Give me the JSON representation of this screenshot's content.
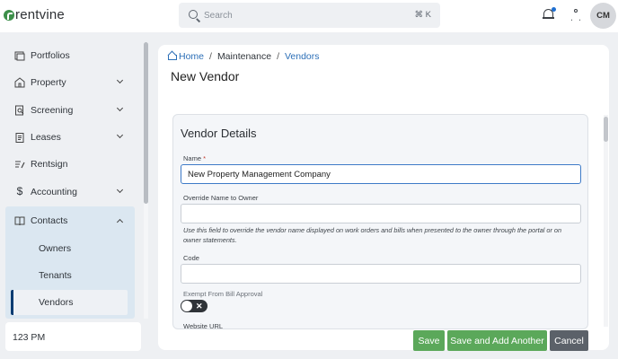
{
  "brand": {
    "wordmark": "rentvine"
  },
  "header": {
    "search_placeholder": "Search",
    "search_shortcut": "⌘ K",
    "avatar_initials": "CM",
    "notification_icon": "bell-icon",
    "profile_icon": "person-icon"
  },
  "sidebar": {
    "items": [
      {
        "label": "Portfolios",
        "icon": "portfolio-icon",
        "expandable": false
      },
      {
        "label": "Property",
        "icon": "property-icon",
        "expandable": true
      },
      {
        "label": "Screening",
        "icon": "screening-icon",
        "expandable": true
      },
      {
        "label": "Leases",
        "icon": "leases-icon",
        "expandable": true
      },
      {
        "label": "Rentsign",
        "icon": "rentsign-icon",
        "expandable": false
      },
      {
        "label": "Accounting",
        "icon": "dollar-icon",
        "expandable": true
      },
      {
        "label": "Contacts",
        "icon": "contacts-icon",
        "expandable": true,
        "expanded": true
      }
    ],
    "contacts_sub": [
      {
        "label": "Owners"
      },
      {
        "label": "Tenants"
      },
      {
        "label": "Vendors",
        "active": true
      }
    ],
    "time": "123 PM"
  },
  "breadcrumb": {
    "home": "Home",
    "maintenance": "Maintenance",
    "vendors": "Vendors"
  },
  "page": {
    "title": "New Vendor"
  },
  "form": {
    "section_title": "Vendor Details",
    "name_label": "Name",
    "name_required": "*",
    "name_value": "New Property Management Company",
    "override_label": "Override Name to Owner",
    "override_value": "",
    "override_help": "Use this field to override the vendor name displayed on work orders and bills when presented to the owner through the portal or on owner statements.",
    "code_label": "Code",
    "code_value": "",
    "exempt_label": "Exempt From Bill Approval",
    "exempt_value": false,
    "website_label": "Website URL"
  },
  "actions": {
    "save": "Save",
    "save_another": "Save and Add Another",
    "cancel": "Cancel"
  },
  "colors": {
    "primary_green": "#5ba85a",
    "link_blue": "#2c6fb7",
    "active_nav": "#0c3c72",
    "cancel_gray": "#5b6169"
  }
}
